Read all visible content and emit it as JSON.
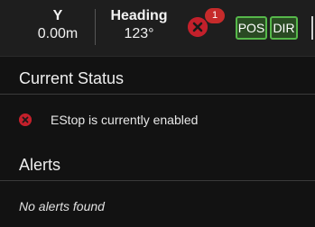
{
  "topbar": {
    "y": {
      "label": "Y",
      "value": "0.00m"
    },
    "heading": {
      "label": "Heading",
      "value": "123°"
    },
    "estop": {
      "icon": "x-circle-icon",
      "badge_count": "1",
      "color": "#c3202b"
    },
    "chips": [
      {
        "label": "POS",
        "color": "#56b84a"
      },
      {
        "label": "DIR",
        "color": "#56b84a"
      }
    ]
  },
  "current_status": {
    "title": "Current Status",
    "items": [
      {
        "icon": "x-circle-icon",
        "text": "EStop is currently enabled"
      }
    ]
  },
  "alerts": {
    "title": "Alerts",
    "empty_text": "No alerts found"
  }
}
